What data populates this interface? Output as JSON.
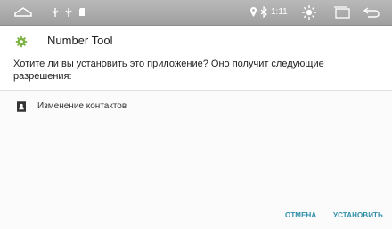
{
  "status_bar": {
    "icons": [
      "home-outline-icon",
      "usb-icon",
      "usb-icon",
      "sd-card-icon",
      "location-icon",
      "bluetooth-icon",
      "brightness-icon",
      "recent-apps-icon",
      "back-icon"
    ],
    "time": "1:11"
  },
  "dialog": {
    "app_name": "Number Tool",
    "prompt": "Хотите ли вы установить это приложение? Оно получит следующие разрешения:",
    "permission_label": "Изменение контактов",
    "cancel_label": "ОТМЕНА",
    "install_label": "УСТАНОВИТЬ"
  },
  "colors": {
    "status_bar": "#a9a9a9",
    "accent": "#2e8ea9",
    "app_icon": "#7cb342"
  }
}
